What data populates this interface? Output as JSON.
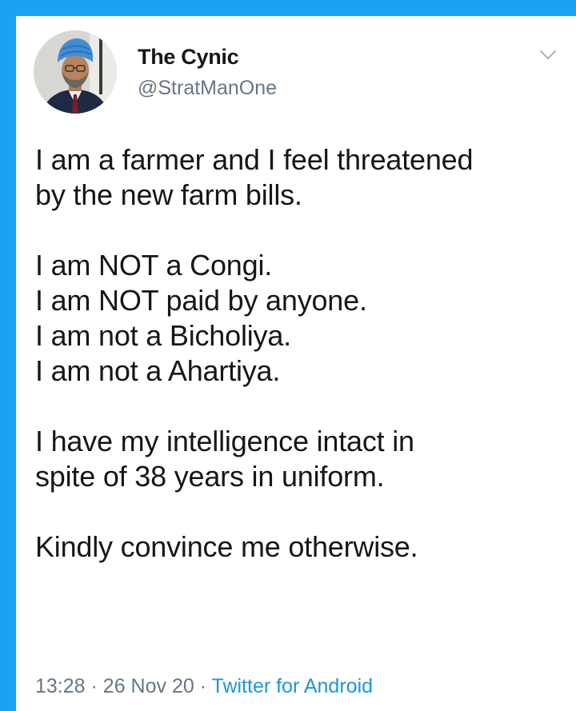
{
  "author": {
    "display_name": "The Cynic",
    "handle": "@StratManOne",
    "avatar_icon": "profile-photo"
  },
  "tweet": {
    "paragraphs": [
      [
        "I am a farmer and I feel threatened",
        "by the new farm bills."
      ],
      [
        "I am NOT a Congi.",
        "I am NOT paid by anyone.",
        "I am not a Bicholiya.",
        "I am not a Ahartiya."
      ],
      [
        "I have my intelligence intact in",
        "spite of 38 years in uniform."
      ],
      [
        "Kindly convince me otherwise."
      ]
    ]
  },
  "meta": {
    "time": "13:28",
    "date": "26 Nov 20",
    "separator": "·",
    "source": "Twitter for Android"
  },
  "colors": {
    "border": "#1DA1F2",
    "link": "#1b95e0",
    "secondary_text": "#657786"
  },
  "icons": {
    "menu": "chevron-down-icon"
  }
}
